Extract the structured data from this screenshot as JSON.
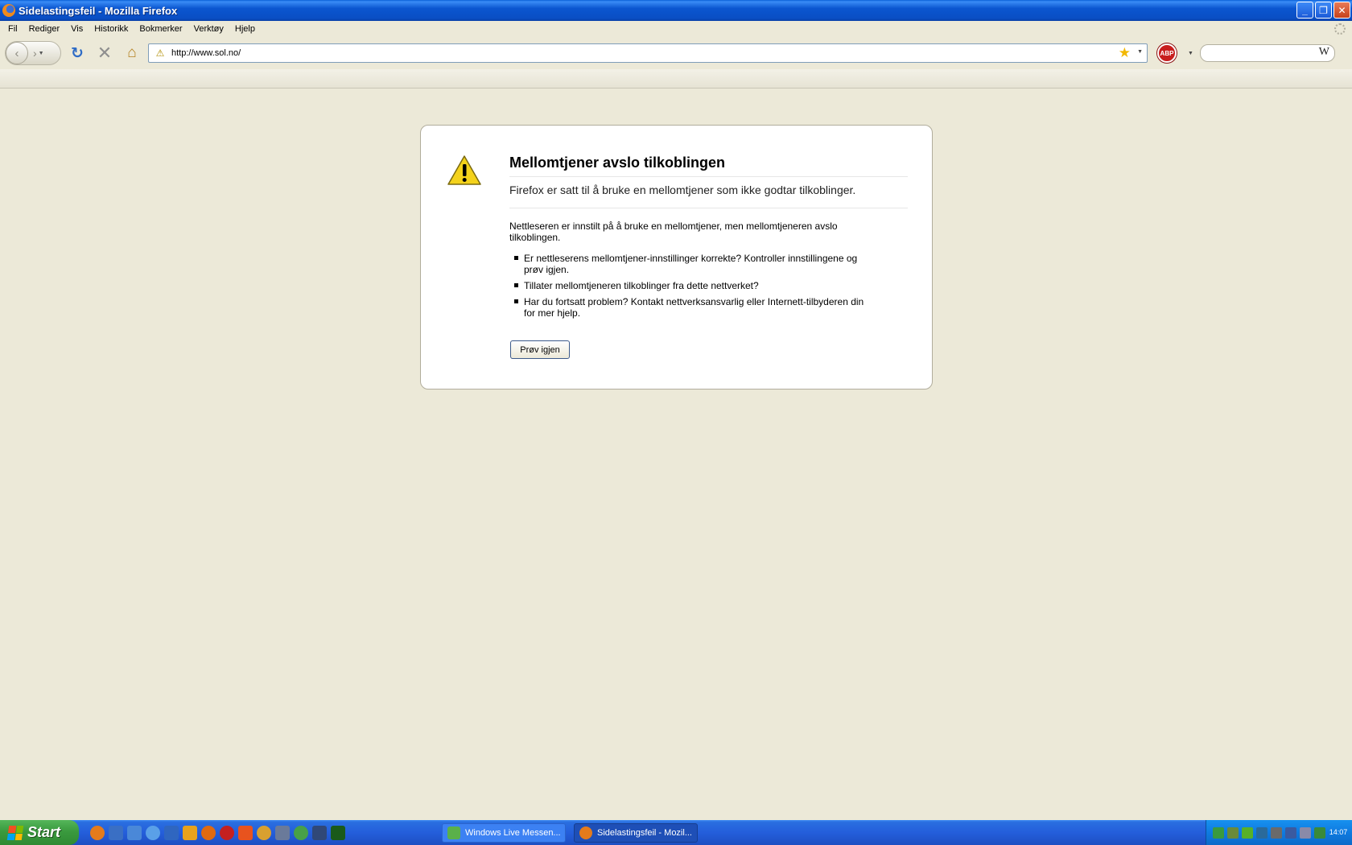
{
  "window": {
    "title": "Sidelastingsfeil - Mozilla Firefox",
    "minimize_glyph": "_",
    "restore_glyph": "❐",
    "close_glyph": "✕"
  },
  "menu": [
    "Fil",
    "Rediger",
    "Vis",
    "Historikk",
    "Bokmerker",
    "Verktøy",
    "Hjelp"
  ],
  "nav": {
    "url": "http://www.sol.no/",
    "abp_label": "ABP",
    "search_engine_icon": "W",
    "icons": [
      "back-icon",
      "forward-icon",
      "reload-icon",
      "stop-icon",
      "home-icon",
      "warning-icon",
      "bookmark-star-icon"
    ]
  },
  "error": {
    "title": "Mellomtjener avslo tilkoblingen",
    "short_desc": "Firefox er satt til å bruke en mellomtjener som ikke godtar tilkoblinger.",
    "long_desc": "Nettleseren er innstilt på å bruke en mellomtjener, men mellomtjeneren avslo tilkoblingen.",
    "bullets": [
      "Er nettleserens mellomtjener-innstillinger korrekte? Kontroller innstillingene og prøv igjen.",
      "Tillater mellomtjeneren tilkoblinger fra dette nettverket?",
      "Har du fortsatt problem? Kontakt nettverksansvarlig eller Internett-tilbyderen din for mer hjelp."
    ],
    "retry_label": "Prøv igjen"
  },
  "taskbar": {
    "start_label": "Start",
    "tasks": [
      {
        "label": "Windows Live Messen..."
      },
      {
        "label": "Sidelastingsfeil - Mozil..."
      }
    ],
    "clock": "14:07"
  }
}
